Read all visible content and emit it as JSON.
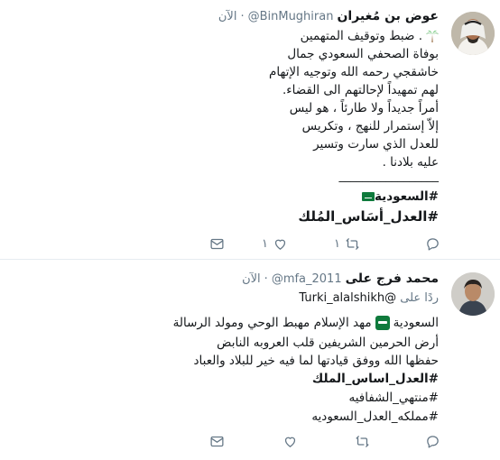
{
  "tweets": [
    {
      "display_name": "عوض بن مُغيران",
      "handle": "@BinMughiran",
      "separator": "·",
      "time": "الآن",
      "lines": [
        ". ضبط وتوقيف المتهمين",
        "بوفاة الصحفي السعودي جمال",
        "خاشقجي رحمه الله وتوجيه الإتهام",
        "لهم تمهيداً لإحالتهم الى القضاء.",
        "أمراً جديداً ولا طارئاً ، هو ليس",
        "إلاّ إستمرار للنهج ، وتكريس",
        "للعدل الذي سارت وتسير",
        "عليه بلادنا ."
      ],
      "divider": "_________________",
      "hashtags": [
        "#السعودية",
        "#العدل_أسَاس_المُلك"
      ],
      "retweets": "١",
      "likes": "١"
    },
    {
      "display_name": "محمد فرج على",
      "handle": "@mfa_2011",
      "separator": "·",
      "time": "الآن",
      "reply_prefix": "ردًا على",
      "reply_to": "@Turki_alalshikh",
      "line1_start": "السعودية",
      "line1_end": "مهد الإسلام مهبط الوحي ومولد الرسالة",
      "line2": "أرض الحرمين الشريفين قلب العروبه النابض",
      "line3": "حفظها الله ووفق قيادتها لما فيه خير للبلاد والعباد",
      "hashtags": [
        "#العدل_اساس_الملك",
        "#منتهي_الشفافيه",
        "#مملكه_العدل_السعوديه"
      ]
    }
  ],
  "icons": {
    "reply": "reply-icon",
    "retweet": "retweet-icon",
    "like": "heart-icon",
    "dm": "envelope-icon"
  },
  "colors": {
    "text": "#14171a",
    "muted": "#657786",
    "border": "#e6ecf0",
    "flag_green": "#0f7a3c"
  }
}
